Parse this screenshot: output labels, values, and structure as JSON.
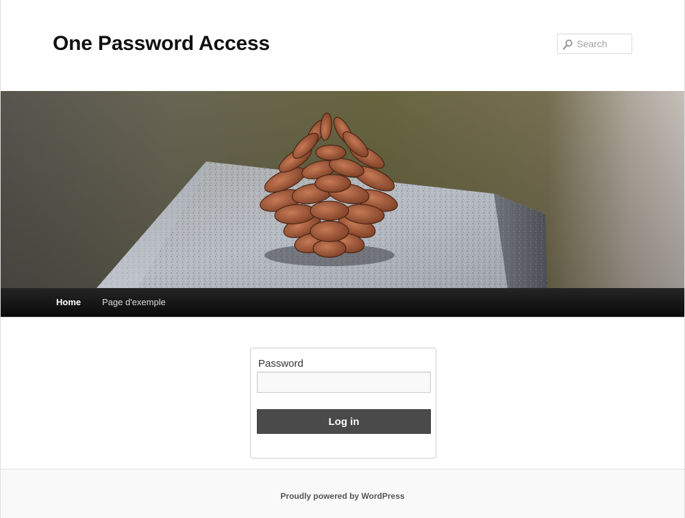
{
  "site": {
    "title": "One Password Access"
  },
  "search": {
    "placeholder": "Search",
    "icon": "search-icon"
  },
  "banner": {
    "description_icon": "pinecone-on-granite-image"
  },
  "nav": {
    "items": [
      {
        "label": "Home"
      },
      {
        "label": "Page d'exemple"
      }
    ]
  },
  "login": {
    "password_label": "Password",
    "password_value": "",
    "button_label": "Log in"
  },
  "footer": {
    "credit": "Proudly powered by WordPress"
  },
  "colors": {
    "nav_bg": "#111111",
    "button_bg": "#4a4a4a",
    "footer_bg": "#f9f9f9",
    "title": "#111111"
  }
}
